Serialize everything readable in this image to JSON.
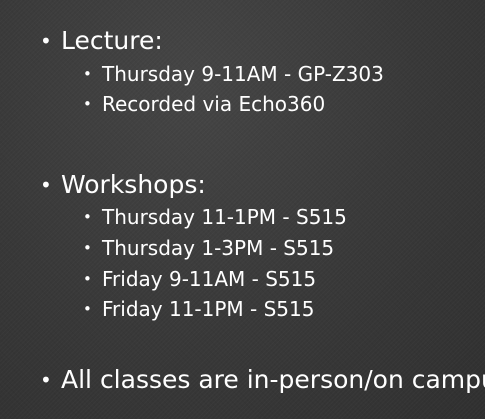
{
  "slide": {
    "lecture": {
      "heading": "Lecture:",
      "items": [
        "Thursday 9-11AM - GP-Z303",
        "Recorded via Echo360"
      ]
    },
    "workshops": {
      "heading": "Workshops:",
      "items": [
        "Thursday 11-1PM - S515",
        "Thursday 1-3PM - S515",
        "Friday 9-11AM - S515",
        "Friday 11-1PM - S515"
      ]
    },
    "note": "All classes are in-person/on campu"
  },
  "colors": {
    "background": "#3b3b3b",
    "text": "#ffffff"
  }
}
